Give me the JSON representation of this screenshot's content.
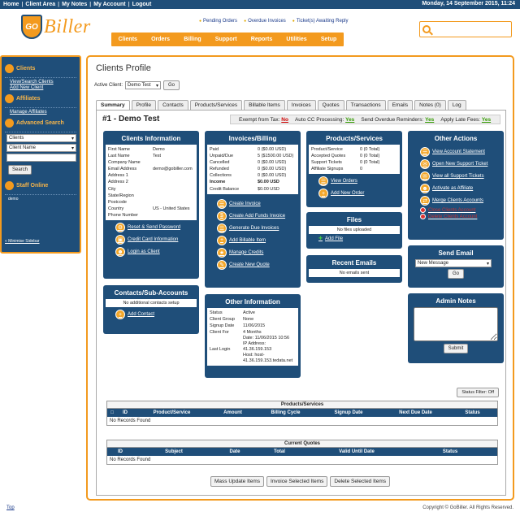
{
  "topbar": {
    "links": [
      "Home",
      "Client Area",
      "My Notes",
      "My Account",
      "Logout"
    ],
    "date": "Monday, 14 September 2015, 11:24"
  },
  "logo": {
    "badge": "GO",
    "word": "Biller"
  },
  "alerts": [
    "Pending Orders",
    "Overdue Invoices",
    "Ticket(s) Awaiting Reply"
  ],
  "nav": [
    "Clients",
    "Orders",
    "Billing",
    "Support",
    "Reports",
    "Utilities",
    "Setup"
  ],
  "sidebar": {
    "clients_title": "Clients",
    "view_search": "View/Search Clients",
    "add_new": "Add New Client",
    "affiliates_title": "Affiliates",
    "manage_affiliates": "Manage Affiliates",
    "advanced_title": "Advanced Search",
    "search_type": "Clients",
    "search_field": "Client Name",
    "search_value": "",
    "search_button": "Search",
    "staff_title": "Staff Online",
    "staff_user": "demo",
    "minimize": "« Minimise Sidebar"
  },
  "page": {
    "title": "Clients Profile",
    "active_client_label": "Active Client:",
    "active_client_value": "Demo Test",
    "go": "Go",
    "client_heading": "#1 - Demo Test"
  },
  "tabs": [
    "Summary",
    "Profile",
    "Contacts",
    "Products/Services",
    "Billable Items",
    "Invoices",
    "Quotes",
    "Transactions",
    "Emails",
    "Notes (0)",
    "Log"
  ],
  "flags": {
    "tax_label": "Exempt from Tax:",
    "tax_value": "No",
    "cc_label": "Auto CC Processing:",
    "cc_value": "Yes",
    "overdue_label": "Send Overdue Reminders:",
    "overdue_value": "Yes",
    "late_label": "Apply Late Fees:",
    "late_value": "Yes"
  },
  "client_info": {
    "title": "Clients Information",
    "rows": [
      {
        "k": "First Name",
        "v": "Demo"
      },
      {
        "k": "Last Name",
        "v": "Test"
      },
      {
        "k": "Company Name",
        "v": ""
      },
      {
        "k": "Email Address",
        "v": "demo@gobiller.com"
      },
      {
        "k": "Address 1",
        "v": ""
      },
      {
        "k": "Address 2",
        "v": ""
      },
      {
        "k": "City",
        "v": ""
      },
      {
        "k": "State/Region",
        "v": ""
      },
      {
        "k": "Postcode",
        "v": ""
      },
      {
        "k": "Country",
        "v": "US - United States"
      },
      {
        "k": "Phone Number",
        "v": ""
      }
    ],
    "actions": [
      "Reset & Send Password",
      "Credit Card Information",
      "Login as Client"
    ]
  },
  "contacts": {
    "title": "Contacts/Sub-Accounts",
    "empty": "No additional contacts setup",
    "add": "Add Contact"
  },
  "invoices": {
    "title": "Invoices/Billing",
    "rows": [
      {
        "k": "Paid",
        "v": "0 ($0.00 USD)"
      },
      {
        "k": "Unpaid/Due",
        "v": "5 ($1500.00 USD)"
      },
      {
        "k": "Cancelled",
        "v": "0 ($0.00 USD)"
      },
      {
        "k": "Refunded",
        "v": "0 ($0.00 USD)"
      },
      {
        "k": "Collections",
        "v": "0 ($0.00 USD)"
      },
      {
        "k": "Income",
        "v": "$0.00 USD"
      },
      {
        "k": "Credit Balance",
        "v": "$0.00 USD"
      }
    ],
    "actions": [
      "Create Invoice",
      "Create Add Funds Invoice",
      "Generate Due Invoices",
      "Add Billable Item",
      "Manage Credits",
      "Create New Quote"
    ]
  },
  "other_info": {
    "title": "Other Information",
    "rows": [
      {
        "k": "Status",
        "v": "Active"
      },
      {
        "k": "Client Group",
        "v": "None"
      },
      {
        "k": "Signup Date",
        "v": "11/06/2015"
      },
      {
        "k": "Client For",
        "v": "4 Months"
      }
    ],
    "last_login_label": "Last Login",
    "last_login_lines": [
      "Date: 11/06/2015 10:56",
      "IP Address:",
      "41.36.159.153",
      "Host: host-",
      "41.36.159.153.tedata.net"
    ]
  },
  "products": {
    "title": "Products/Services",
    "rows": [
      {
        "k": "Product/Service",
        "v": "0 (0 Total)"
      },
      {
        "k": "Accepted Quotes",
        "v": "0 (0 Total)"
      },
      {
        "k": "Support Tickets",
        "v": "0 (0 Total)"
      },
      {
        "k": "Affiliate Signups",
        "v": "0"
      }
    ],
    "actions": [
      "View Orders",
      "Add New Order"
    ]
  },
  "files": {
    "title": "Files",
    "empty": "No files uploaded",
    "add": "Add File"
  },
  "emails": {
    "title": "Recent Emails",
    "empty": "No emails sent"
  },
  "other_actions": {
    "title": "Other Actions",
    "actions": [
      "View Account Statement",
      "Open New Support Ticket",
      "View all Support Tickets",
      "Activate as Affiliate",
      "Merge Clients Accounts"
    ],
    "danger": [
      "Close Clients Account",
      "Delete Clients Account"
    ]
  },
  "send_email": {
    "title": "Send Email",
    "template": "New Message",
    "go": "Go"
  },
  "admin_notes": {
    "title": "Admin Notes",
    "submit": "Submit"
  },
  "status_filter": "Status Filter: Off",
  "products_table": {
    "caption": "Products/Services",
    "headers": [
      "",
      "ID",
      "Product/Service",
      "Amount",
      "Billing Cycle",
      "Signup Date",
      "Next Due Date",
      "Status"
    ],
    "empty": "No Records Found"
  },
  "quotes_table": {
    "caption": "Current Quotes",
    "headers": [
      "ID",
      "Subject",
      "Date",
      "Total",
      "Valid Until Date",
      "Status"
    ],
    "empty": "No Records Found"
  },
  "bottom_buttons": [
    "Mass Update Items",
    "Invoice Selected Items",
    "Delete Selected Items"
  ],
  "footer": {
    "top": "Top",
    "copyright": "Copyright © GoBiller. All Rights Reserved."
  },
  "colors": {
    "navy": "#1f4e79",
    "orange": "#f39a1e"
  }
}
